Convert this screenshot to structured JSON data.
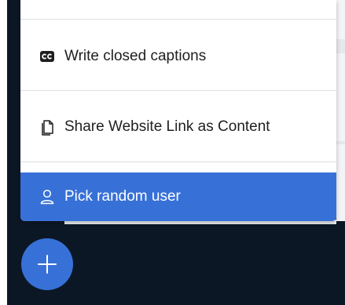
{
  "menu": {
    "items": [
      {
        "label": "Write closed captions",
        "icon": "closed-captions-icon",
        "highlighted": false
      },
      {
        "label": "Share Website Link as Content",
        "icon": "share-content-icon",
        "highlighted": false
      },
      {
        "label": "Pick random user",
        "icon": "user-icon",
        "highlighted": true
      }
    ]
  },
  "fab": {
    "icon": "plus-icon"
  },
  "colors": {
    "accent": "#3771d8",
    "background": "#0c1726",
    "menu_background": "#ffffff",
    "text": "#1f1f1f",
    "highlight_text": "#ffffff"
  }
}
